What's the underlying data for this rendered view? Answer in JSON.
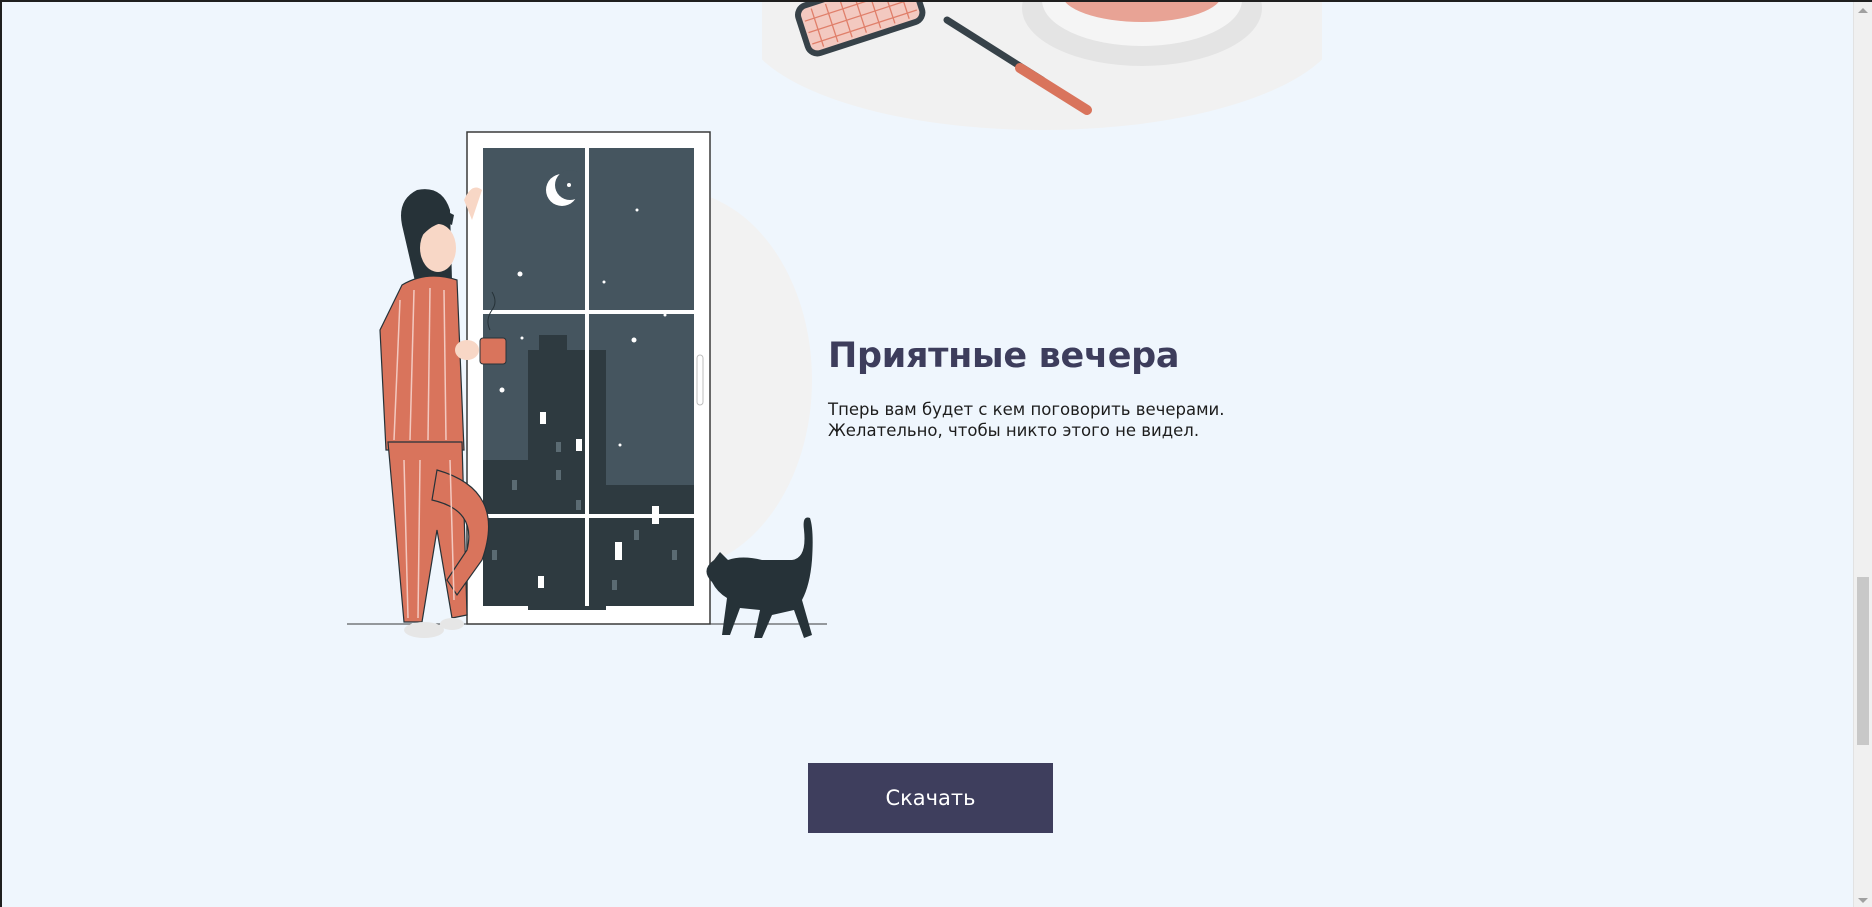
{
  "section": {
    "headline": "Приятные вечера",
    "body_line_1": "Тперь вам будет с кем поговорить вечерами.",
    "body_line_2": "Желательно, чтобы никто этого не видел."
  },
  "actions": {
    "download_label": "Скачать"
  },
  "colors": {
    "page_background": "#eff6fd",
    "headline": "#3d3d5c",
    "button_background": "#3e3e5d",
    "pajama_accent": "#d9745c",
    "window_night": "#45555f"
  },
  "icons": {
    "top": "tennis-racket-illustration",
    "hero": "woman-at-window-with-cat-illustration"
  }
}
